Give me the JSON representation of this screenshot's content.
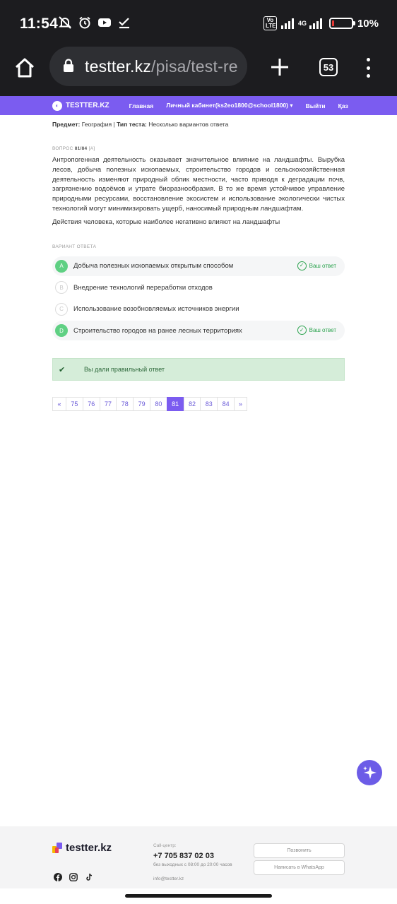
{
  "status_bar": {
    "time": "11:54",
    "network": "4G",
    "volte": "Vo LTE",
    "battery": "10%",
    "icons": [
      "mute-icon",
      "alarm-icon",
      "youtube-icon",
      "check-icon",
      "signal-icon",
      "battery-icon"
    ]
  },
  "browser": {
    "url_host": "testter.kz",
    "url_path": "/pisa/test-re",
    "tab_count": "53"
  },
  "site_nav": {
    "logo": "TESTTER.KZ",
    "links": [
      "Главная",
      "Личный кабинет(ks2eo1800@school1800) ▾",
      "Выйти",
      "Қаз"
    ]
  },
  "meta": {
    "subject_label": "Предмет:",
    "subject": "География",
    "separator": "|",
    "type_label": "Тип теста:",
    "type": "Несколько вариантов ответа"
  },
  "question": {
    "label": "ВОПРОС",
    "number": "81/84",
    "weight": "[A]",
    "text": "Антропогенная деятельность оказывает значительное влияние на ландшафты. Вырубка лесов, добыча полезных ископаемых, строительство городов и сельскохозяйственная деятельность изменяют природный облик местности, часто приводя к деградации почв, загрязнению водоёмов и утрате биоразнообразия. В то же время устойчивое управление природными ресурсами, восстановление экосистем и использование экологически чистых технологий могут минимизировать ущерб, наносимый природным ландшафтам.",
    "prompt": "Действия человека, которые наиболее негативно влияют на ландшафты"
  },
  "answers": {
    "label": "ВАРИАНТ ОТВЕТА",
    "your_answer_label": "Ваш ответ",
    "options": [
      {
        "letter": "A",
        "text": "Добыча полезных ископаемых открытым способом",
        "selected": true
      },
      {
        "letter": "B",
        "text": "Внедрение технологий переработки отходов",
        "selected": false
      },
      {
        "letter": "C",
        "text": "Использование возобновляемых источников энергии",
        "selected": false
      },
      {
        "letter": "D",
        "text": "Строительство городов на ранее лесных территориях",
        "selected": true
      }
    ]
  },
  "result": {
    "message": "Вы дали правильный ответ",
    "status_color": "#d5edd9"
  },
  "pagination": {
    "prev": "«",
    "pages": [
      "75",
      "76",
      "77",
      "78",
      "79",
      "80",
      "81",
      "82",
      "83",
      "84"
    ],
    "current": "81",
    "next": "»"
  },
  "footer": {
    "logo": "testter.kz",
    "call_label": "Call-центр:",
    "phone": "+7 705 837 02 03",
    "hours": "без выходных с 08:00 до 20:00 часов",
    "email": "info@testter.kz",
    "call_button": "Позвонить",
    "whatsapp_button": "Написать в WhatsApp",
    "social_icons": [
      "facebook-icon",
      "instagram-icon",
      "tiktok-icon"
    ]
  },
  "colors": {
    "brand": "#7b5cf0",
    "correct": "#5fd083",
    "success_text": "#2ba34e"
  }
}
